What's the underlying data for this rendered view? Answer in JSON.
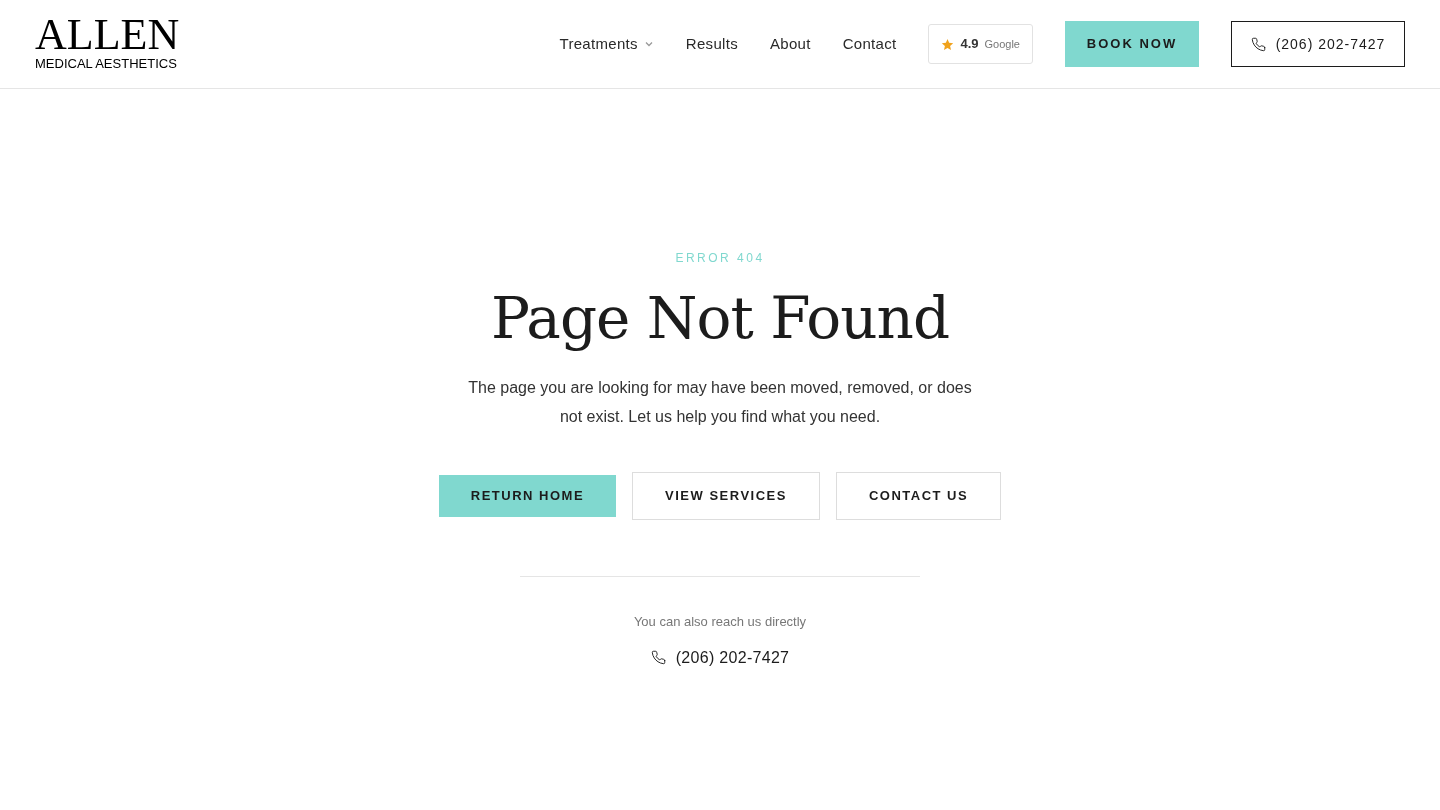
{
  "header": {
    "logo": {
      "title": "ALLEN",
      "subtitle": "MEDICAL AESTHETICS"
    },
    "nav": [
      {
        "label": "Treatments",
        "has_dropdown": true
      },
      {
        "label": "Results",
        "has_dropdown": false
      },
      {
        "label": "About",
        "has_dropdown": false
      },
      {
        "label": "Contact",
        "has_dropdown": false
      }
    ],
    "rating": {
      "score": "4.9",
      "source": "Google"
    },
    "book_button": "BOOK NOW",
    "phone_button": "(206) 202-7427"
  },
  "error": {
    "eyebrow": "ERROR 404",
    "title": "Page Not Found",
    "message": "The page you are looking for may have been moved, removed, or does not exist. Let us help you find what you need.",
    "buttons": [
      {
        "label": "RETURN HOME",
        "kind": "primary"
      },
      {
        "label": "VIEW SERVICES",
        "kind": "outline"
      },
      {
        "label": "CONTACT US",
        "kind": "outline"
      }
    ],
    "contact_note": "You can also reach us directly",
    "phone": "(206) 202-7427"
  }
}
